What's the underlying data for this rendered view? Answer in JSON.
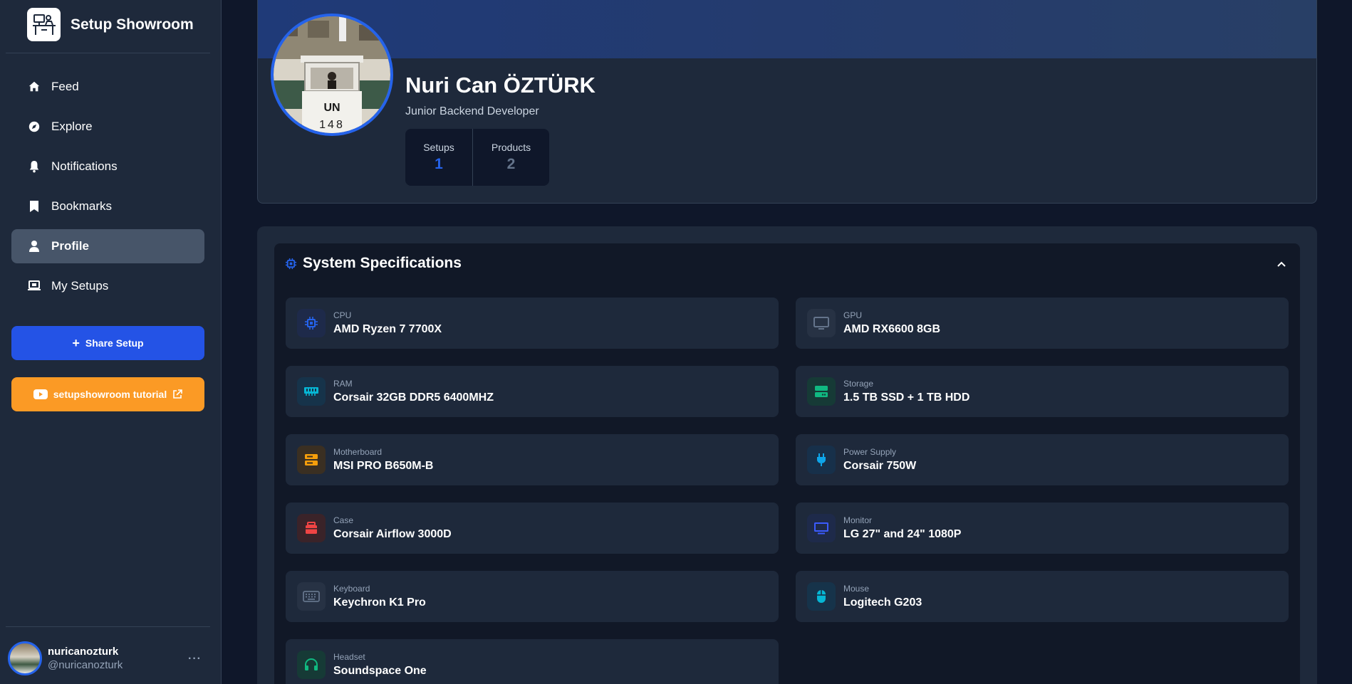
{
  "app": {
    "name": "Setup Showroom"
  },
  "nav": [
    {
      "label": "Feed",
      "icon": "home-icon"
    },
    {
      "label": "Explore",
      "icon": "compass-icon"
    },
    {
      "label": "Notifications",
      "icon": "bell-icon"
    },
    {
      "label": "Bookmarks",
      "icon": "bookmark-icon"
    },
    {
      "label": "Profile",
      "icon": "user-icon",
      "active": true
    },
    {
      "label": "My Setups",
      "icon": "laptop-icon"
    }
  ],
  "actions": {
    "share_label": "Share Setup",
    "tutorial_label": "setupshowroom tutorial"
  },
  "current_user": {
    "username": "nuricanozturk",
    "handle": "@nuricanozturk",
    "more": "···"
  },
  "profile": {
    "name": "Nuri Can ÖZTÜRK",
    "role": "Junior Backend Developer",
    "stats": [
      {
        "label": "Setups",
        "value": "1"
      },
      {
        "label": "Products",
        "value": "2"
      }
    ],
    "avatar_sign": "UN",
    "avatar_number": "148"
  },
  "specs": {
    "title": "System Specifications",
    "items": [
      {
        "label": "CPU",
        "value": "AMD Ryzen 7 7700X",
        "icon": "cpu-icon",
        "color": "#2563eb"
      },
      {
        "label": "GPU",
        "value": "AMD RX6600 8GB",
        "icon": "gpu-icon",
        "color": "#64748b"
      },
      {
        "label": "RAM",
        "value": "Corsair 32GB DDR5 6400MHZ",
        "icon": "memory-icon",
        "color": "#06b6d4"
      },
      {
        "label": "Storage",
        "value": "1.5 TB SSD + 1 TB HDD",
        "icon": "storage-icon",
        "color": "#10b981"
      },
      {
        "label": "Motherboard",
        "value": "MSI PRO B650M-B",
        "icon": "motherboard-icon",
        "color": "#f59e0b"
      },
      {
        "label": "Power Supply",
        "value": "Corsair 750W",
        "icon": "plug-icon",
        "color": "#0ea5e9"
      },
      {
        "label": "Case",
        "value": "Corsair Airflow 3000D",
        "icon": "case-icon",
        "color": "#ef4444"
      },
      {
        "label": "Monitor",
        "value": "LG 27\" and 24\" 1080P",
        "icon": "monitor-icon",
        "color": "#3b5bfd"
      },
      {
        "label": "Keyboard",
        "value": "Keychron K1 Pro",
        "icon": "keyboard-icon",
        "color": "#64748b"
      },
      {
        "label": "Mouse",
        "value": "Logitech G203",
        "icon": "mouse-icon",
        "color": "#06b6d4"
      },
      {
        "label": "Headset",
        "value": "Soundspace One",
        "icon": "headset-icon",
        "color": "#10b981"
      }
    ]
  }
}
